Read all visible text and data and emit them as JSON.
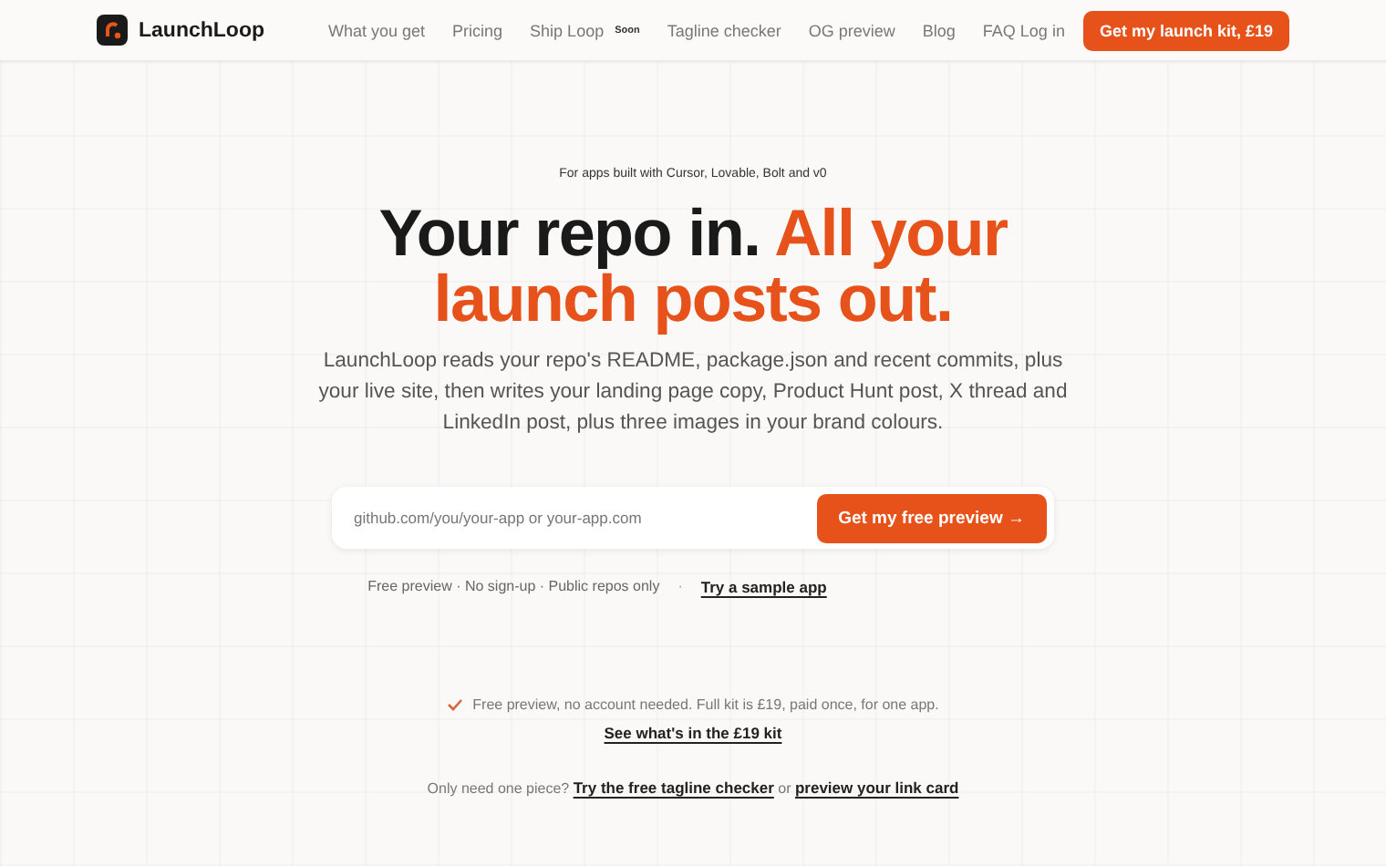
{
  "nav": {
    "brand": "LaunchLoop",
    "links": [
      {
        "label": "What you get"
      },
      {
        "label": "Pricing"
      },
      {
        "label": "Ship Loop",
        "badge": "Soon"
      },
      {
        "label": "Tagline checker"
      },
      {
        "label": "OG preview"
      },
      {
        "label": "Blog"
      },
      {
        "label": "FAQ"
      }
    ],
    "login": "Log in",
    "cta": "Get my launch kit, £19"
  },
  "hero": {
    "eyebrow": "For apps built with Cursor, Lovable, Bolt and v0",
    "headline": {
      "dark": "Your repo in.",
      "accent": "All your launch posts out."
    },
    "description": "LaunchLoop reads your repo's README, package.json and recent commits, plus your live site, then writes your landing page copy, Product Hunt post, X thread and LinkedIn post, plus three images in your brand colours.",
    "input": {
      "placeholder": "github.com/you/your-app or your-app.com"
    },
    "submit": "Get my free preview →",
    "note": "Free preview · No sign-up · Public repos only",
    "separator": "·",
    "sample_link": "Try a sample app"
  },
  "footer": {
    "check_text": "Free preview, no account needed. Full kit is £19, paid once, for one app.",
    "kit_link": "See what's in the £19 kit",
    "cross_sell": {
      "prefix": "Only need one piece?",
      "link_1": "Try the free tagline checker",
      "middle": "or",
      "link_2": "preview your link card"
    }
  }
}
